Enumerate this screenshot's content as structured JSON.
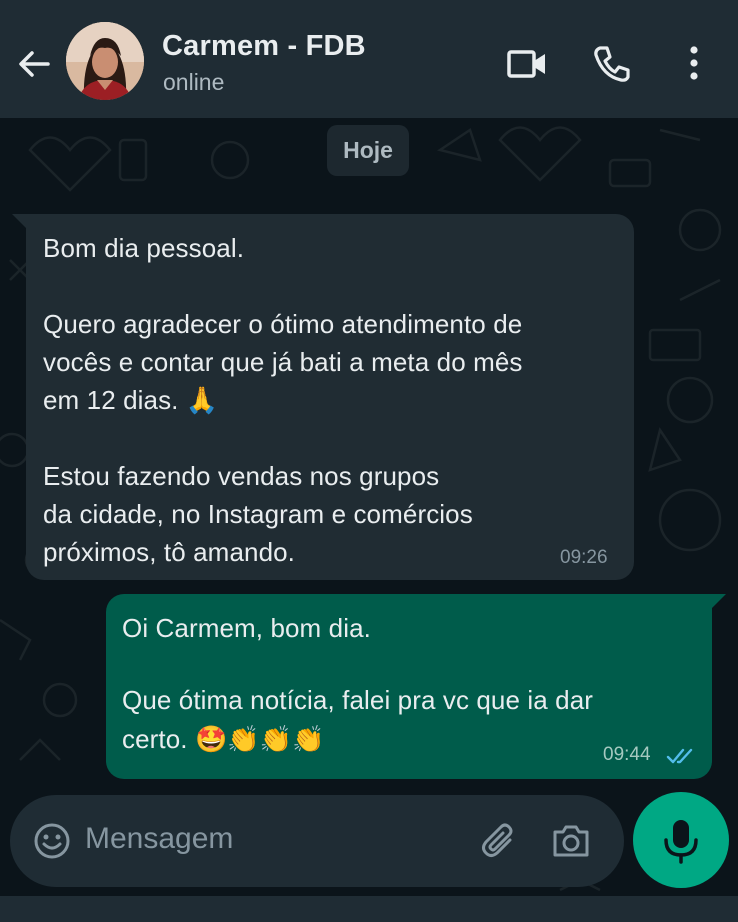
{
  "header": {
    "contact_name": "Carmem - FDB",
    "status": "online"
  },
  "date_chip": "Hoje",
  "messages": [
    {
      "direction": "incoming",
      "lines": [
        "Bom dia pessoal.",
        "",
        "Quero agradecer o ótimo atendimento de",
        "vocês e contar que já bati a meta do mês",
        "em 12 dias. 🙏",
        "",
        "Estou fazendo vendas nos grupos",
        "da cidade, no Instagram e comércios",
        "próximos, tô amando."
      ],
      "time": "09:26"
    },
    {
      "direction": "outgoing",
      "lines": [
        "Oi Carmem, bom dia.",
        "",
        "Que ótima notícia, falei pra vc que ia dar",
        "certo. 🤩👏👏👏"
      ],
      "time": "09:44",
      "read_receipt": "double-check-read"
    }
  ],
  "composer": {
    "placeholder": "Mensagem"
  },
  "colors": {
    "background": "#0b141a",
    "header": "#1f2c34",
    "incoming_bubble": "#202c33",
    "outgoing_bubble": "#005c4b",
    "accent": "#00a884",
    "read_tick": "#53bdeb"
  },
  "icons": {
    "back": "arrow-left-icon",
    "video": "video-call-icon",
    "call": "phone-icon",
    "menu": "more-vert-icon",
    "emoji": "emoji-icon",
    "attach": "paperclip-icon",
    "camera": "camera-icon",
    "mic": "microphone-icon"
  }
}
